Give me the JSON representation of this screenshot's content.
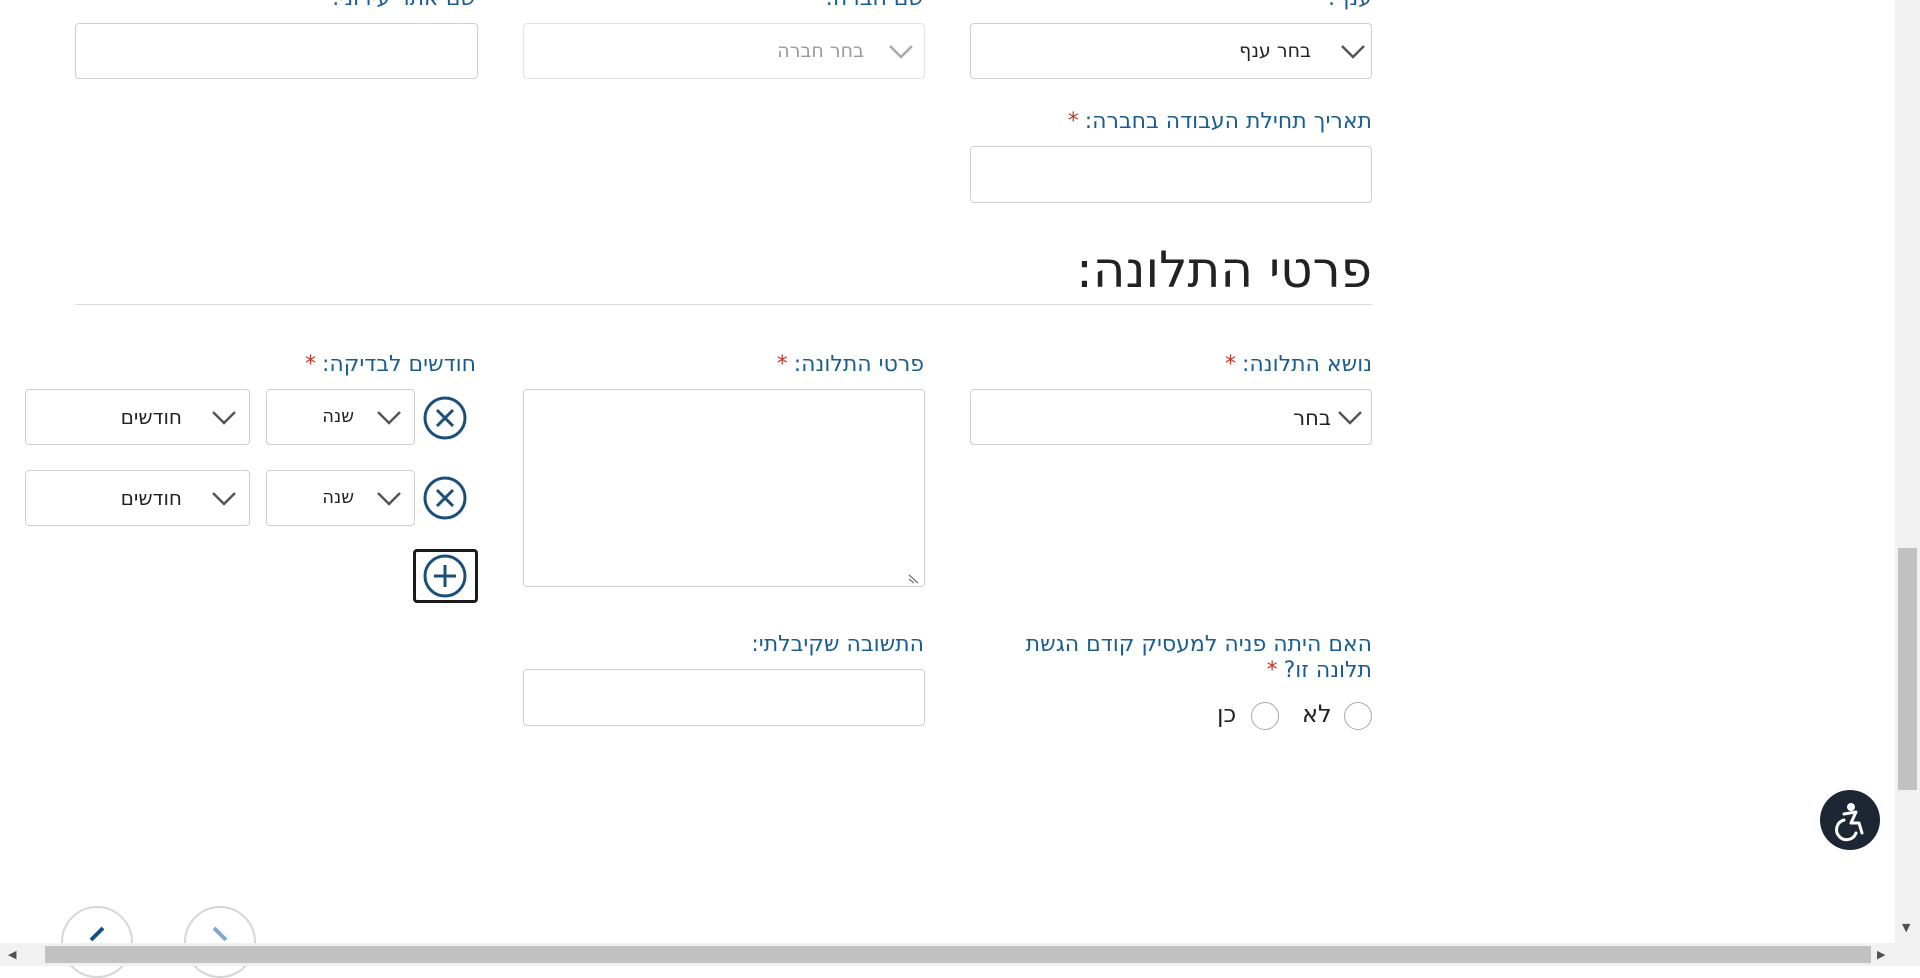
{
  "top_row": {
    "branch_label": "ענף:",
    "company_label": "שם חברה:",
    "other_site_label": "שם אתר עירוני:",
    "branch_select": "בחר ענף",
    "company_select": "בחר חברה"
  },
  "start_date": {
    "label": "תאריך תחילת העבודה בחברה:",
    "required_mark": "*",
    "value": ""
  },
  "complaint_section": {
    "heading": "פרטי התלונה:"
  },
  "complaint_topic": {
    "label": "נושא התלונה:",
    "required_mark": "*",
    "select": "בחר"
  },
  "complaint_details": {
    "label": "פרטי התלונה:",
    "required_mark": "*",
    "value": ""
  },
  "months_check": {
    "label": "חודשים לבדיקה:",
    "required_mark": "*",
    "rows": [
      {
        "year_select": "שנה",
        "months_select": "חודשים"
      },
      {
        "year_select": "שנה",
        "months_select": "חודשים"
      }
    ]
  },
  "prior_appeal": {
    "label_line1": "האם היתה פניה למעסיק קודם הגשת",
    "label_line2": "תלונה זו?",
    "required_mark": "*",
    "options": [
      "לא",
      "כן"
    ]
  },
  "answer_received": {
    "label": "התשובה שקיבלתי:",
    "value": ""
  },
  "icons": [
    "remove-icon",
    "add-icon",
    "chevron-down-icon",
    "accessibility-icon",
    "resize-grip-icon"
  ],
  "colors": {
    "label_blue": "#1a5d8f",
    "required_red": "#c0392b",
    "icon_navy": "#1b4f7a",
    "accessibility_bg": "#1c2733"
  }
}
